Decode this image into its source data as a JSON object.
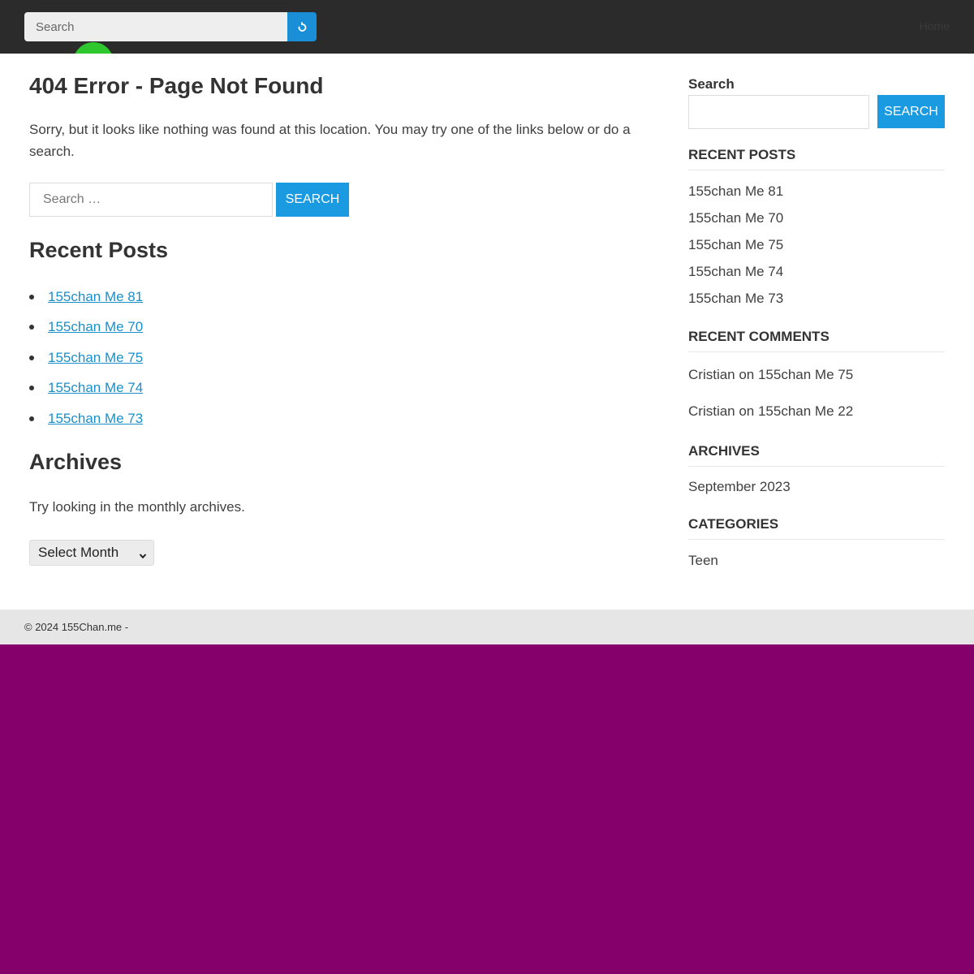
{
  "header": {
    "search_placeholder": "Search",
    "search_icon": "search-icon",
    "nav_item": "Home",
    "logo_icon": "logo-icon"
  },
  "main": {
    "title": "404 Error - Page Not Found",
    "intro": "Sorry, but it looks like nothing was found at this location. You may try one of the links below or do a search.",
    "search_placeholder": "Search …",
    "search_button": "Search",
    "recent_title": "Recent Posts",
    "recent_posts": [
      "155chan Me 81",
      "155chan Me 70",
      "155chan Me 75",
      "155chan Me 74",
      "155chan Me 73"
    ],
    "archives_title": "Archives",
    "archives_text": "Try looking in the monthly archives.",
    "month_select": "Select Month"
  },
  "sidebar": {
    "search_label": "Search",
    "search_button": "Search",
    "recent_posts_title": "Recent Posts",
    "recent_posts": [
      "155chan Me 81",
      "155chan Me 70",
      "155chan Me 75",
      "155chan Me 74",
      "155chan Me 73"
    ],
    "recent_comments_title": "Recent Comments",
    "recent_comments": [
      "Cristian on 155chan Me 75",
      "Cristian on 155chan Me 22"
    ],
    "archives_title": "Archives",
    "archives": [
      "September 2023"
    ],
    "categories_title": "Categories",
    "categories": [
      "Teen"
    ]
  },
  "footer": {
    "copyright": "© 2024 155Chan.me -"
  },
  "colors": {
    "topbar": "#2b2b2b",
    "accent": "#1a9ae0",
    "link": "#1a8fc9",
    "page_background": "#85006b",
    "footer": "#e6e6e6"
  }
}
